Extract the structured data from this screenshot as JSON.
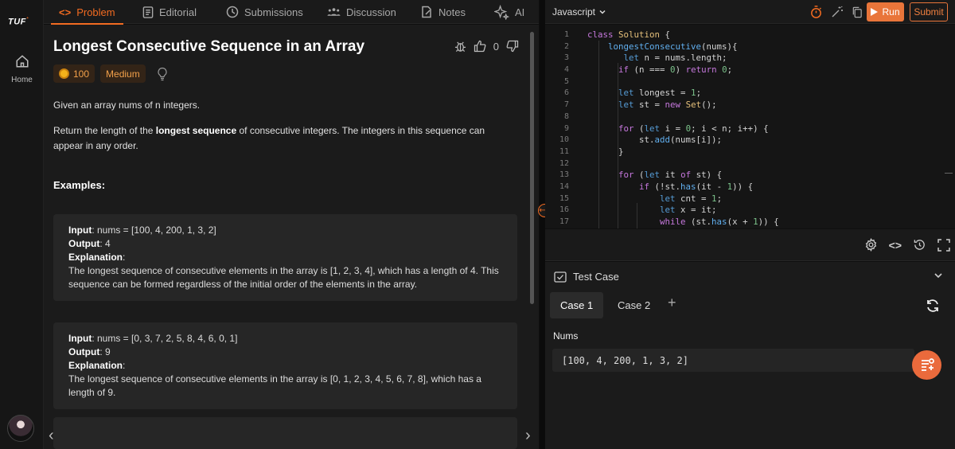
{
  "brand": {
    "logo": "TUF",
    "logo_mark": "⁺",
    "home_label": "Home"
  },
  "tabs": [
    {
      "label": "Problem",
      "icon": "code-icon",
      "active": true
    },
    {
      "label": "Editorial",
      "icon": "document-icon"
    },
    {
      "label": "Submissions",
      "icon": "clock-icon"
    },
    {
      "label": "Discussion",
      "icon": "people-icon"
    },
    {
      "label": "Notes",
      "icon": "notes-icon"
    },
    {
      "label": "AI",
      "icon": "sparkle-icon"
    }
  ],
  "problem": {
    "title": "Longest Consecutive Sequence in an Array",
    "likes": "0",
    "coins": "100",
    "difficulty": "Medium",
    "desc1": "Given an array nums of n integers.",
    "desc2_pre": "Return the length of the ",
    "desc2_bold": "longest sequence",
    "desc2_post": " of consecutive integers. The integers in this sequence can appear in any order.",
    "examples_heading": "Examples:",
    "examples": [
      {
        "input_label": "Input",
        "input": ": nums = [100, 4, 200, 1, 3, 2]",
        "output_label": "Output",
        "output": ": 4",
        "explanation_label": "Explanation",
        "explanation": "The longest sequence of consecutive elements in the array is [1, 2, 3, 4], which has a length of 4. This sequence can be formed regardless of the initial order of the elements in the array."
      },
      {
        "input_label": "Input",
        "input": ": nums = [0, 3, 7, 2, 5, 8, 4, 6, 0, 1]",
        "output_label": "Output",
        "output": ": 9",
        "explanation_label": "Explanation",
        "explanation": "The longest sequence of consecutive elements in the array is [0, 1, 2, 3, 4, 5, 6, 7, 8], which has a length of 9."
      }
    ]
  },
  "editor": {
    "language": "Javascript",
    "run_label": "Run",
    "submit_label": "Submit",
    "line_numbers": [
      "1",
      "2",
      "3",
      "4",
      "5",
      "6",
      "7",
      "8",
      "9",
      "10",
      "11",
      "12",
      "13",
      "14",
      "15",
      "16",
      "17"
    ]
  },
  "testcase": {
    "title": "Test Case",
    "cases": [
      "Case 1",
      "Case 2"
    ],
    "add": "+",
    "param_label": "Nums",
    "param_value": "[100, 4, 200, 1, 3, 2]"
  },
  "colors": {
    "accent": "#f26b21",
    "panel": "#1b1b1b",
    "editor": "#151515"
  }
}
